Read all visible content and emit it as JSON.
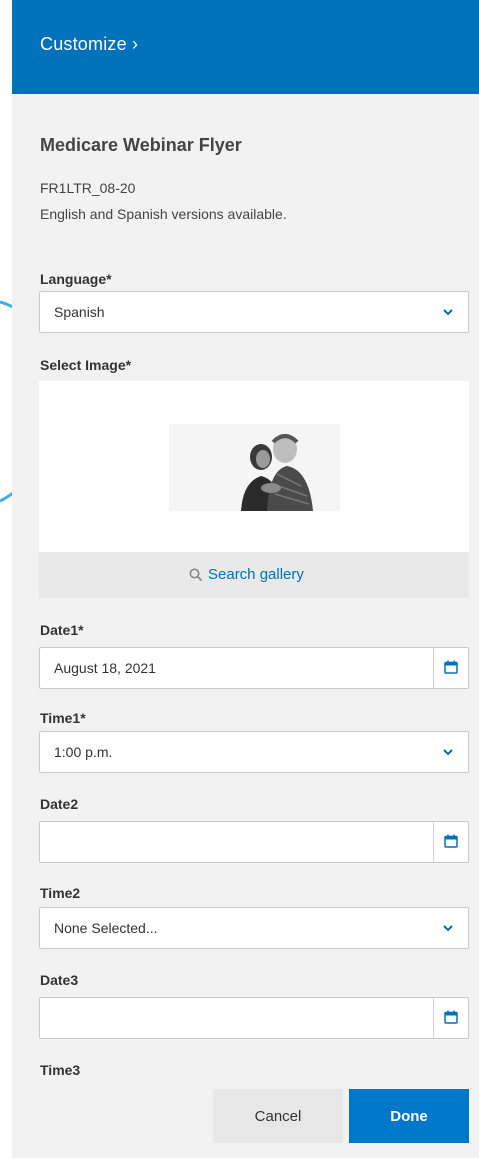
{
  "header": {
    "link_label": "Customize ›"
  },
  "item": {
    "title": "Medicare Webinar Flyer",
    "code": "FR1LTR_08-20",
    "description": "English and Spanish versions available."
  },
  "fields": {
    "language": {
      "label": "Language*",
      "value": "Spanish"
    },
    "select_image": {
      "label": "Select Image*",
      "search_label": "Search gallery"
    },
    "date1": {
      "label": "Date1*",
      "value": "August 18, 2021"
    },
    "time1": {
      "label": "Time1*",
      "value": "1:00 p.m."
    },
    "date2": {
      "label": "Date2",
      "value": ""
    },
    "time2": {
      "label": "Time2",
      "value": "None Selected..."
    },
    "date3": {
      "label": "Date3",
      "value": ""
    },
    "time3": {
      "label": "Time3"
    }
  },
  "actions": {
    "cancel_label": "Cancel",
    "done_label": "Done"
  },
  "colors": {
    "accent": "#0072bc",
    "panel": "#f2f2f2",
    "arrow": "#3ab0e8"
  },
  "icons": [
    "chevron-down-icon",
    "calendar-icon",
    "search-icon",
    "annotation-arrow-icon"
  ]
}
